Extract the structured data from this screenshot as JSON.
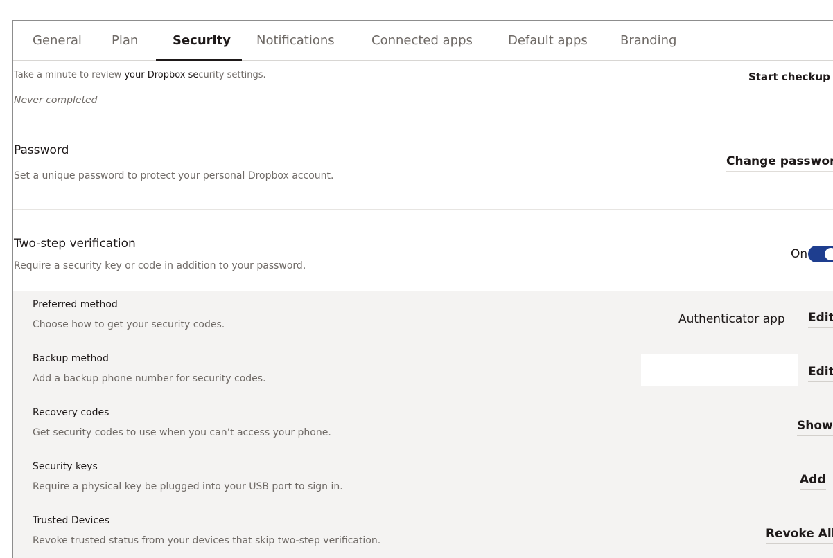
{
  "tabs": [
    {
      "label": "General"
    },
    {
      "label": "Plan"
    },
    {
      "label": "Security"
    },
    {
      "label": "Notifications"
    },
    {
      "label": "Connected apps"
    },
    {
      "label": "Default apps"
    },
    {
      "label": "Branding"
    }
  ],
  "active_tab": "Security",
  "checkup": {
    "desc_start": "Take a minute to review ",
    "desc_struck": "your Dropbox se",
    "desc_end": "curity settings.",
    "status": "Never completed",
    "button_label": "Start checkup"
  },
  "password": {
    "title": "Password",
    "desc": "Set a unique password to protect your personal Dropbox account.",
    "button_label": "Change password"
  },
  "two_step": {
    "title": "Two-step verification",
    "desc": "Require a security key or code in addition to your password.",
    "toggle_label": "On",
    "enabled": true
  },
  "sub_rows": {
    "preferred": {
      "title": "Preferred method",
      "desc": "Choose how to get your security codes.",
      "value": "Authenticator app",
      "button_label": "Edit"
    },
    "backup": {
      "title": "Backup method",
      "desc": "Add a backup phone number for security codes.",
      "button_label": "Edit"
    },
    "recovery": {
      "title": "Recovery codes",
      "desc": "Get security codes to use when you can’t access your phone.",
      "button_label": "Show"
    },
    "keys": {
      "title": "Security keys",
      "desc": "Require a physical key be plugged into your USB port to sign in.",
      "button_label": "Add"
    },
    "trusted": {
      "title": "Trusted Devices",
      "desc": "Revoke trusted status from your devices that skip two-step verification.",
      "button_label": "Revoke All"
    }
  },
  "colors": {
    "toggle_on": "#1e3e8f",
    "grey_section": "#f4f3f2",
    "text_primary": "#1e1919",
    "text_secondary": "#6f6a66"
  }
}
